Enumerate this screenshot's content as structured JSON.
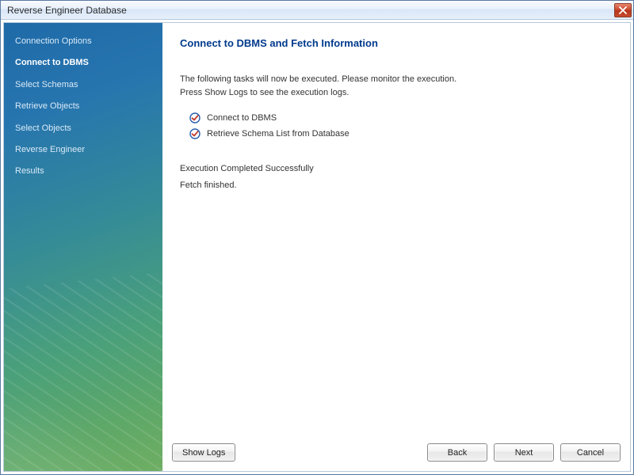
{
  "window": {
    "title": "Reverse Engineer Database"
  },
  "sidebar": {
    "items": [
      {
        "label": "Connection Options",
        "active": false
      },
      {
        "label": "Connect to DBMS",
        "active": true
      },
      {
        "label": "Select Schemas",
        "active": false
      },
      {
        "label": "Retrieve Objects",
        "active": false
      },
      {
        "label": "Select Objects",
        "active": false
      },
      {
        "label": "Reverse Engineer",
        "active": false
      },
      {
        "label": "Results",
        "active": false
      }
    ]
  },
  "main": {
    "heading": "Connect to DBMS and Fetch Information",
    "intro_line1": "The following tasks will now be executed. Please monitor the execution.",
    "intro_line2": "Press Show Logs to see the execution logs.",
    "tasks": [
      {
        "label": "Connect to DBMS",
        "done": true
      },
      {
        "label": "Retrieve Schema List from Database",
        "done": true
      }
    ],
    "status_line1": "Execution Completed Successfully",
    "status_line2": "Fetch finished."
  },
  "buttons": {
    "show_logs": "Show Logs",
    "back": "Back",
    "next": "Next",
    "cancel": "Cancel"
  }
}
